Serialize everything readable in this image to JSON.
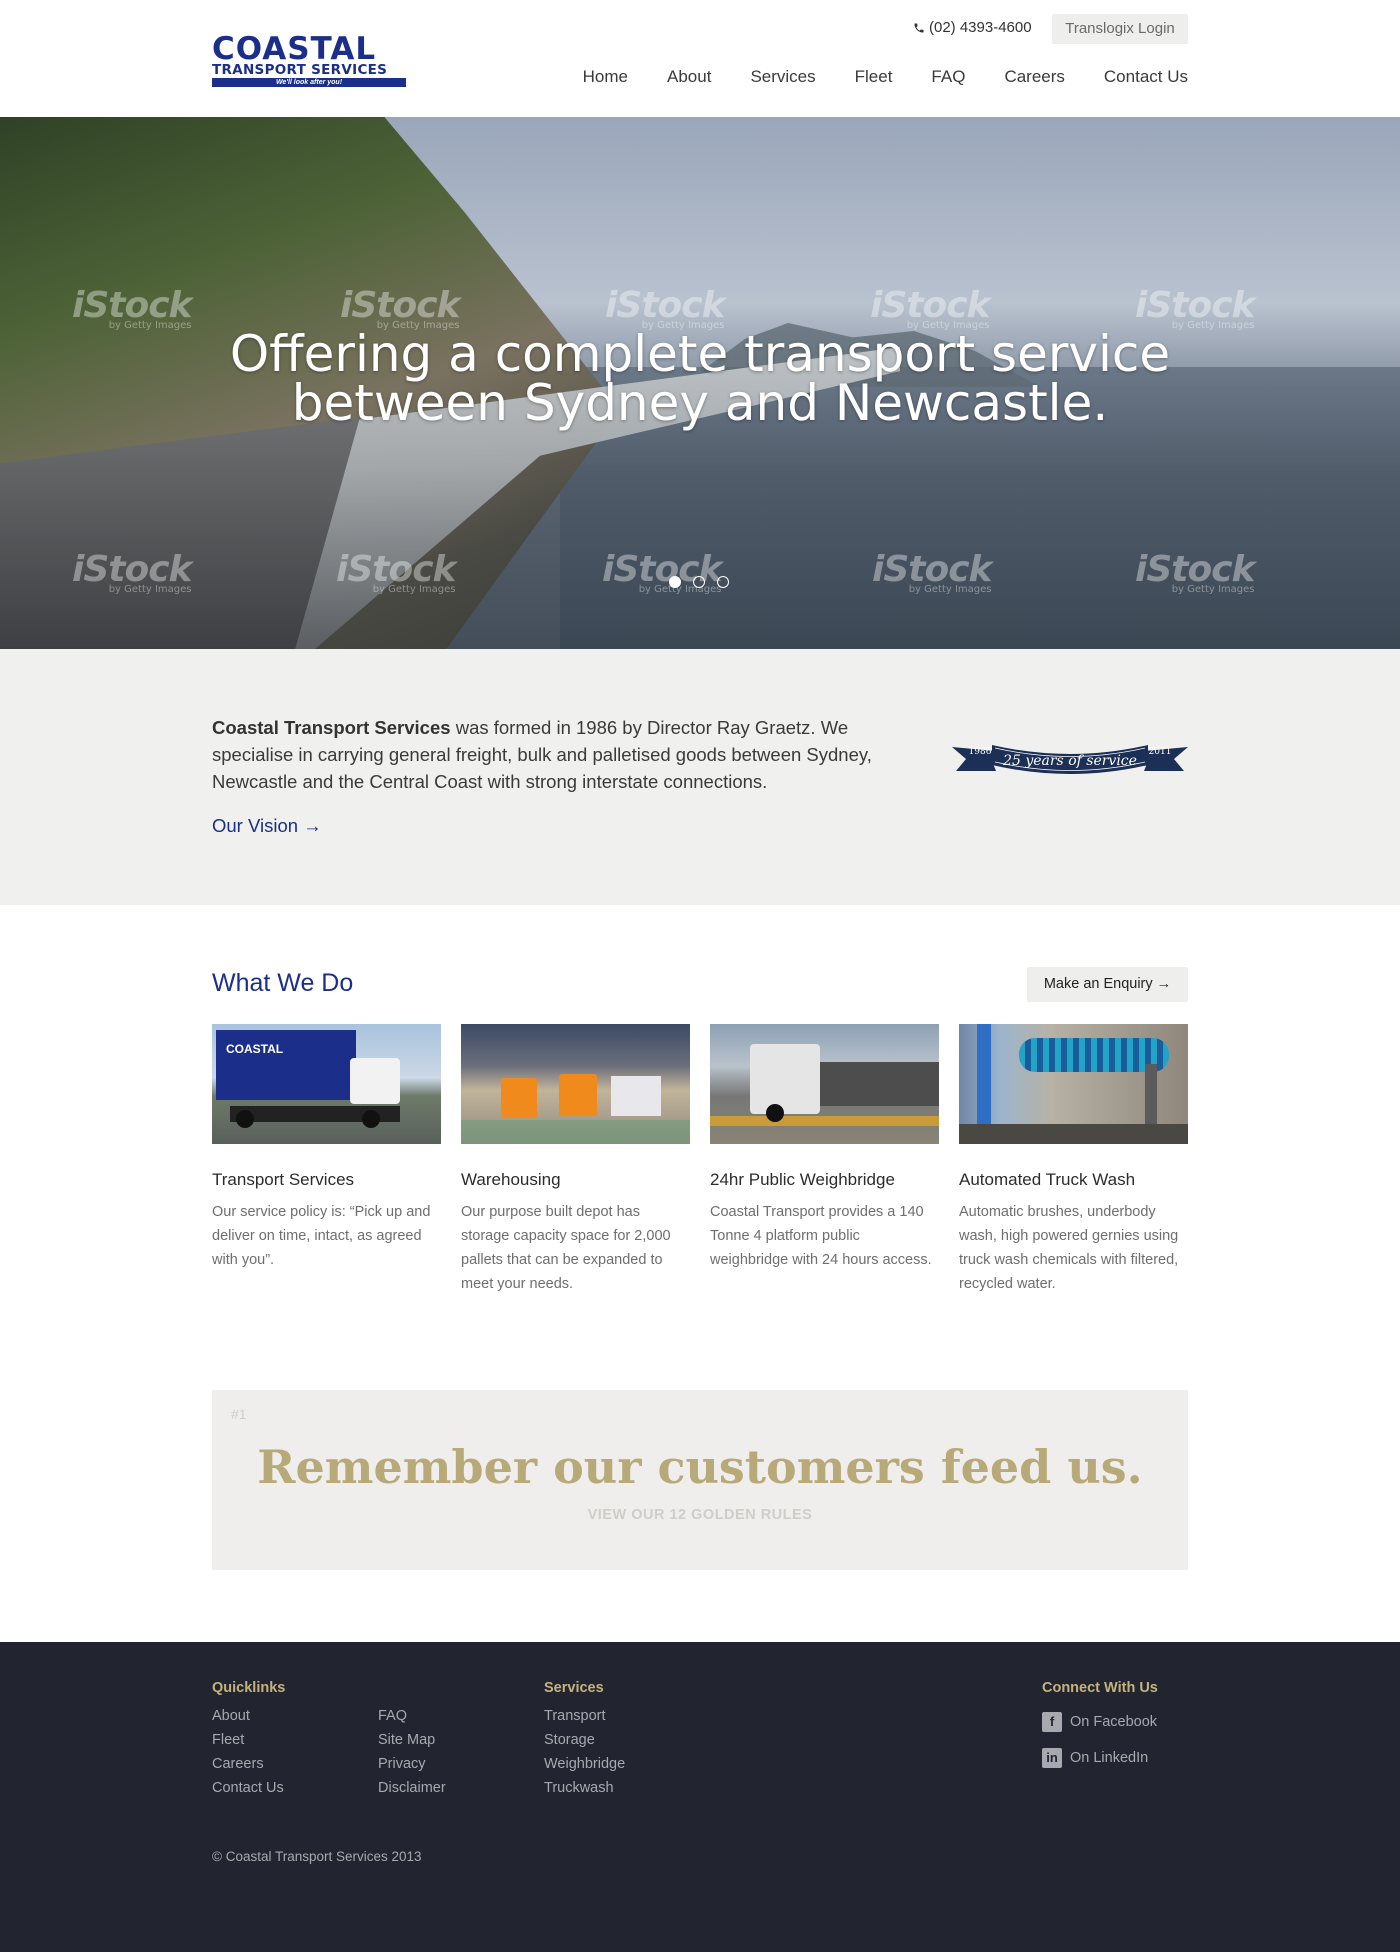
{
  "header": {
    "logo": {
      "main": "COASTAL",
      "sub": "TRANSPORT SERVICES",
      "tagline": "We'll look after you!"
    },
    "phone": "(02) 4393-4600",
    "login_label": "Translogix Login",
    "nav": [
      "Home",
      "About",
      "Services",
      "Fleet",
      "FAQ",
      "Careers",
      "Contact Us"
    ]
  },
  "hero": {
    "headline_line1": "Offering a complete transport service",
    "headline_line2": "between Sydney and Newcastle.",
    "watermark": "iStock",
    "watermark_sub": "by Getty Images",
    "slides": 3,
    "active_slide": 1
  },
  "about": {
    "company": "Coastal Transport Services",
    "text": " was formed in 1986 by Director Ray Graetz. We specialise in carrying general freight, bulk and palletised goods between Sydney, Newcastle and the Central Coast with strong interstate connections.",
    "vision_link": "Our Vision →",
    "badge": {
      "left_year": "1986",
      "right_year": "2011",
      "caption": "25 years of service"
    }
  },
  "what_we_do": {
    "title": "What We Do",
    "enquiry_label": "Make an Enquiry →",
    "cards": [
      {
        "title": "Transport Services",
        "desc": "Our service policy is: “Pick up and deliver on time, intact, as agreed with you”."
      },
      {
        "title": "Warehousing",
        "desc": "Our purpose built depot has storage capacity space for 2,000 pallets that can be expanded to meet your needs."
      },
      {
        "title": "24hr Public Weighbridge",
        "desc": "Coastal Transport provides a 140 Tonne 4 platform public weighbridge with 24 hours access."
      },
      {
        "title": "Automated Truck Wash",
        "desc": "Automatic brushes, underbody wash, high powered gernies using truck wash chemicals with filtered, recycled water."
      }
    ]
  },
  "rules": {
    "tag": "#1",
    "quote": "Remember our customers feed us.",
    "link": "VIEW OUR 12 GOLDEN RULES"
  },
  "footer": {
    "quicklinks_title": "Quicklinks",
    "quicklinks_col1": [
      "About",
      "Fleet",
      "Careers",
      "Contact Us"
    ],
    "quicklinks_col2": [
      "FAQ",
      "Site Map",
      "Privacy",
      "Disclaimer"
    ],
    "services_title": "Services",
    "services": [
      "Transport",
      "Storage",
      "Weighbridge",
      "Truckwash"
    ],
    "connect_title": "Connect With Us",
    "facebook_label": "On Facebook",
    "linkedin_label": "On LinkedIn",
    "copyright": "© Coastal Transport Services 2013"
  },
  "colors": {
    "brand_blue": "#1b2f8a",
    "gold": "#b8a978",
    "footer_bg": "#22252f",
    "about_bg": "#f0f0ef"
  }
}
